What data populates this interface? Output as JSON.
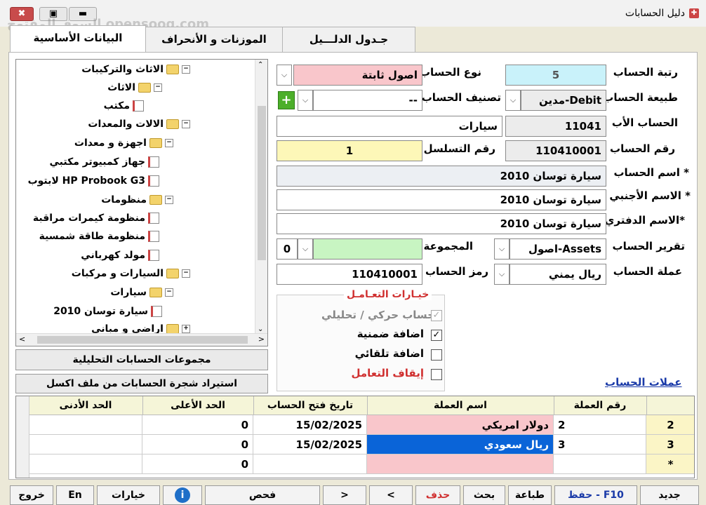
{
  "window": {
    "title": "دليل الحسابات",
    "min": "▬",
    "max": "▣",
    "close": "✖"
  },
  "watermark": "السوق المفتوح opensooq.com",
  "tabs": [
    {
      "label": "البيانات الأساسية"
    },
    {
      "label": "الموزنات و الأنحراف"
    },
    {
      "label": "جـدول الدلـــيل"
    }
  ],
  "form": {
    "rank_label": "رتبة الحساب",
    "rank_value": "5",
    "nature_label": "طبيعة الحساب",
    "nature_value": "مدين-Debit",
    "parent_label": "الحساب الأب",
    "parent_code": "11041",
    "parent_name": "سيارات",
    "number_label": "رقم الحساب",
    "number_value": "110410001",
    "name_label": "اسم الحساب *",
    "name_value": "سيارة توسان 2010",
    "foreign_label": "الاسم الأجنبي *",
    "foreign_value": "سيارة توسان 2010",
    "book_label": "الاسم الدفتري*",
    "book_value": "سيارة توسان 2010",
    "report_label": "تقرير الحساب",
    "report_value": "اصول-Assets",
    "currency_label": "عملة الحساب",
    "currency_value": "ريال يمني",
    "type_label": "نوع الحساب",
    "type_value": "اصول ثابتة",
    "class_label": "تصنيف الحساب",
    "class_value": "--",
    "serial_label": "رقم التسلسل",
    "serial_value": "1",
    "group_label": "المجموعة",
    "group_value": "0",
    "symbol_label": "رمز الحساب",
    "symbol_value": "110410001"
  },
  "options": {
    "title": "خيـارات التعـامـل",
    "items": [
      {
        "label": "حساب حركي / تحليلي",
        "checked": true,
        "disabled": true
      },
      {
        "label": "اضافة ضمنية",
        "checked": true
      },
      {
        "label": "اضافة تلقائي",
        "checked": false
      },
      {
        "label": "إيقاف التعامل",
        "checked": false
      }
    ]
  },
  "tree": [
    {
      "label": "الاثاث والتركيبات",
      "kind": "folder"
    },
    {
      "label": "الاثاث",
      "kind": "folder"
    },
    {
      "label": "مكتب",
      "kind": "doc"
    },
    {
      "label": "الالات والمعدات",
      "kind": "folder"
    },
    {
      "label": "اجهزة و معدات",
      "kind": "folder"
    },
    {
      "label": "جهاز كمبيوتر مكتبي",
      "kind": "doc"
    },
    {
      "label": "لابتوب HP Probook G3",
      "kind": "doc"
    },
    {
      "label": "منظومات",
      "kind": "folder"
    },
    {
      "label": "منظومة كيمرات مراقبة",
      "kind": "doc"
    },
    {
      "label": "منظومة طاقة شمسية",
      "kind": "doc"
    },
    {
      "label": "مولد كهرباني",
      "kind": "doc"
    },
    {
      "label": "السيارات و مركبات",
      "kind": "folder"
    },
    {
      "label": "سيارات",
      "kind": "folder"
    },
    {
      "label": "سيارة توسان 2010",
      "kind": "doc"
    },
    {
      "label": "اراضي و مباني",
      "kind": "folder"
    }
  ],
  "side_buttons": {
    "groups": "مجموعات الحسابات التحليلية",
    "import": "استيراد شجرة الحسابات من ملف اكسل"
  },
  "currencies_title": "عملات الحساب",
  "grid": {
    "headers": [
      "رقم العملة",
      "اسم العملة",
      "تاريخ فتح الحساب",
      "الحد الأعلى",
      "الحد الأدنى"
    ],
    "rows": [
      {
        "row": "2",
        "code": "2",
        "name": "دولار امريكي",
        "date": "15/02/2025",
        "max": "0",
        "min": ""
      },
      {
        "row": "3",
        "code": "3",
        "name": "ريال سعودي",
        "date": "15/02/2025",
        "max": "0",
        "min": ""
      },
      {
        "row": "*",
        "code": "",
        "name": "",
        "date": "",
        "max": "0",
        "min": ""
      }
    ]
  },
  "bottom_buttons": {
    "new": "جديد",
    "save": "حفظ - F10",
    "print": "طباعة",
    "search": "بحث",
    "delete": "حذف",
    "prev": "<",
    "next": ">",
    "check": "فحص",
    "info": "i",
    "options": "خيارات",
    "lang": "En",
    "exit": "خروج"
  }
}
